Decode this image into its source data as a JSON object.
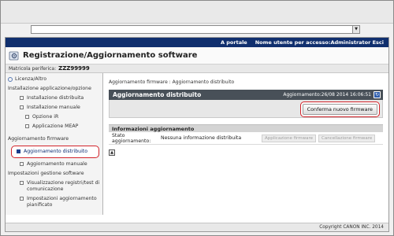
{
  "address_bar": {
    "value": ""
  },
  "header": {
    "portal_link": "A portale",
    "user_label": "Nome utente per accesso:Administrator Esci",
    "title": "Registrazione/Aggiornamento software",
    "device_label": "Matricola periferica:",
    "device_id": "ZZZ99999"
  },
  "sidebar": {
    "license": "Licenza/Altro",
    "install_section": "Installazione applicazione/opzione",
    "items": [
      "Installazione distribuita",
      "Installazione manuale",
      "Opzione iR",
      "Applicazione MEAP"
    ],
    "firmware_section": "Aggiornamento firmware",
    "firmware_items": [
      "Aggiornamento distribuito",
      "Aggiornamento manuale"
    ],
    "mgmt_section": "Impostazioni gestione software",
    "mgmt_items": [
      "Visualizzazione registri/test di comunicazione",
      "Impostazioni aggiornamento pianificato"
    ]
  },
  "main": {
    "breadcrumb": "Aggiornamento firmware : Aggiornamento distribuito",
    "panel_title": "Aggiornamento distribuito",
    "updated": "Aggiornamento:26/08 2014 16:06:51",
    "confirm_button": "Conferma nuovo firmware",
    "info_title": "Informazioni aggiornamento",
    "status_label": "Stato aggiornamento:",
    "status_value": "Nessuna informazione distribuita",
    "apply_button": "Applicazione firmware",
    "cancel_button": "Cancellazione firmware"
  },
  "footer": {
    "copyright": "Copyright CANON INC. 2014"
  }
}
